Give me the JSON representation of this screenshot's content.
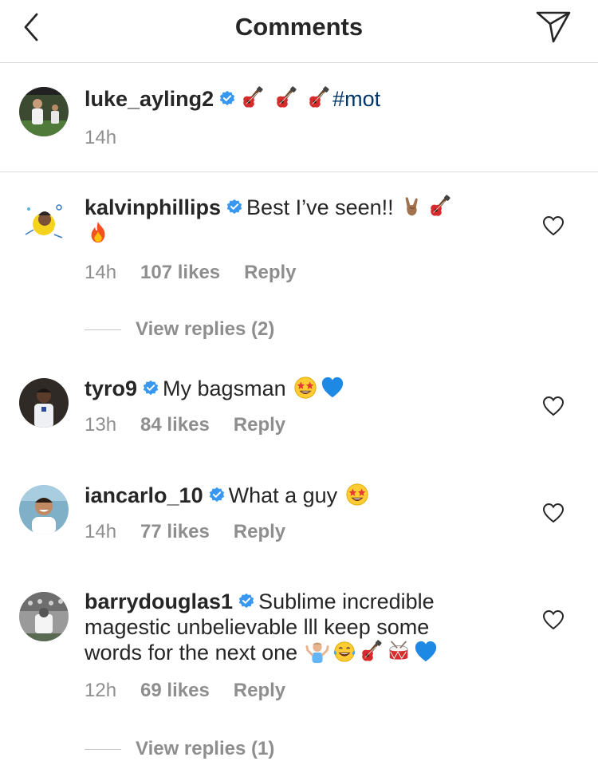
{
  "header": {
    "title": "Comments"
  },
  "caption": {
    "username": "luke_ayling2",
    "text": "#mot",
    "emojis": [
      "guitar-emoji",
      "guitar-emoji",
      "guitar-emoji"
    ],
    "time": "14h"
  },
  "comments": [
    {
      "username": "kalvinphillips",
      "text_before": "Best I’ve seen!!",
      "emojis": [
        "sign-of-horns-emoji",
        "guitar-emoji",
        "fire-emoji"
      ],
      "time": "14h",
      "likes": "107 likes",
      "reply": "Reply",
      "view_replies": "View replies (2)"
    },
    {
      "username": "tyro9",
      "text_before": "My bagsman",
      "emojis": [
        "star-struck-emoji",
        "blue-heart-emoji"
      ],
      "time": "13h",
      "likes": "84 likes",
      "reply": "Reply"
    },
    {
      "username": "iancarlo_10",
      "text_before": "What a guy",
      "emojis": [
        "star-struck-emoji"
      ],
      "time": "14h",
      "likes": "77 likes",
      "reply": "Reply"
    },
    {
      "username": "barrydouglas1",
      "text_line1": "Sublime incredible",
      "text_line2": "magestic unbelievable lll keep some",
      "text_line3": "words for the next one",
      "emojis": [
        "man-shrugging-emoji",
        "tears-of-joy-emoji",
        "guitar-emoji",
        "drum-emoji",
        "blue-heart-emoji"
      ],
      "time": "12h",
      "likes": "69 likes",
      "reply": "Reply",
      "view_replies": "View replies (1)"
    }
  ],
  "colors": {
    "text": "#262626",
    "meta": "#8e8e8e",
    "verified": "#3897f0",
    "hashtag": "#00376b",
    "divider": "#dbdbdb"
  }
}
